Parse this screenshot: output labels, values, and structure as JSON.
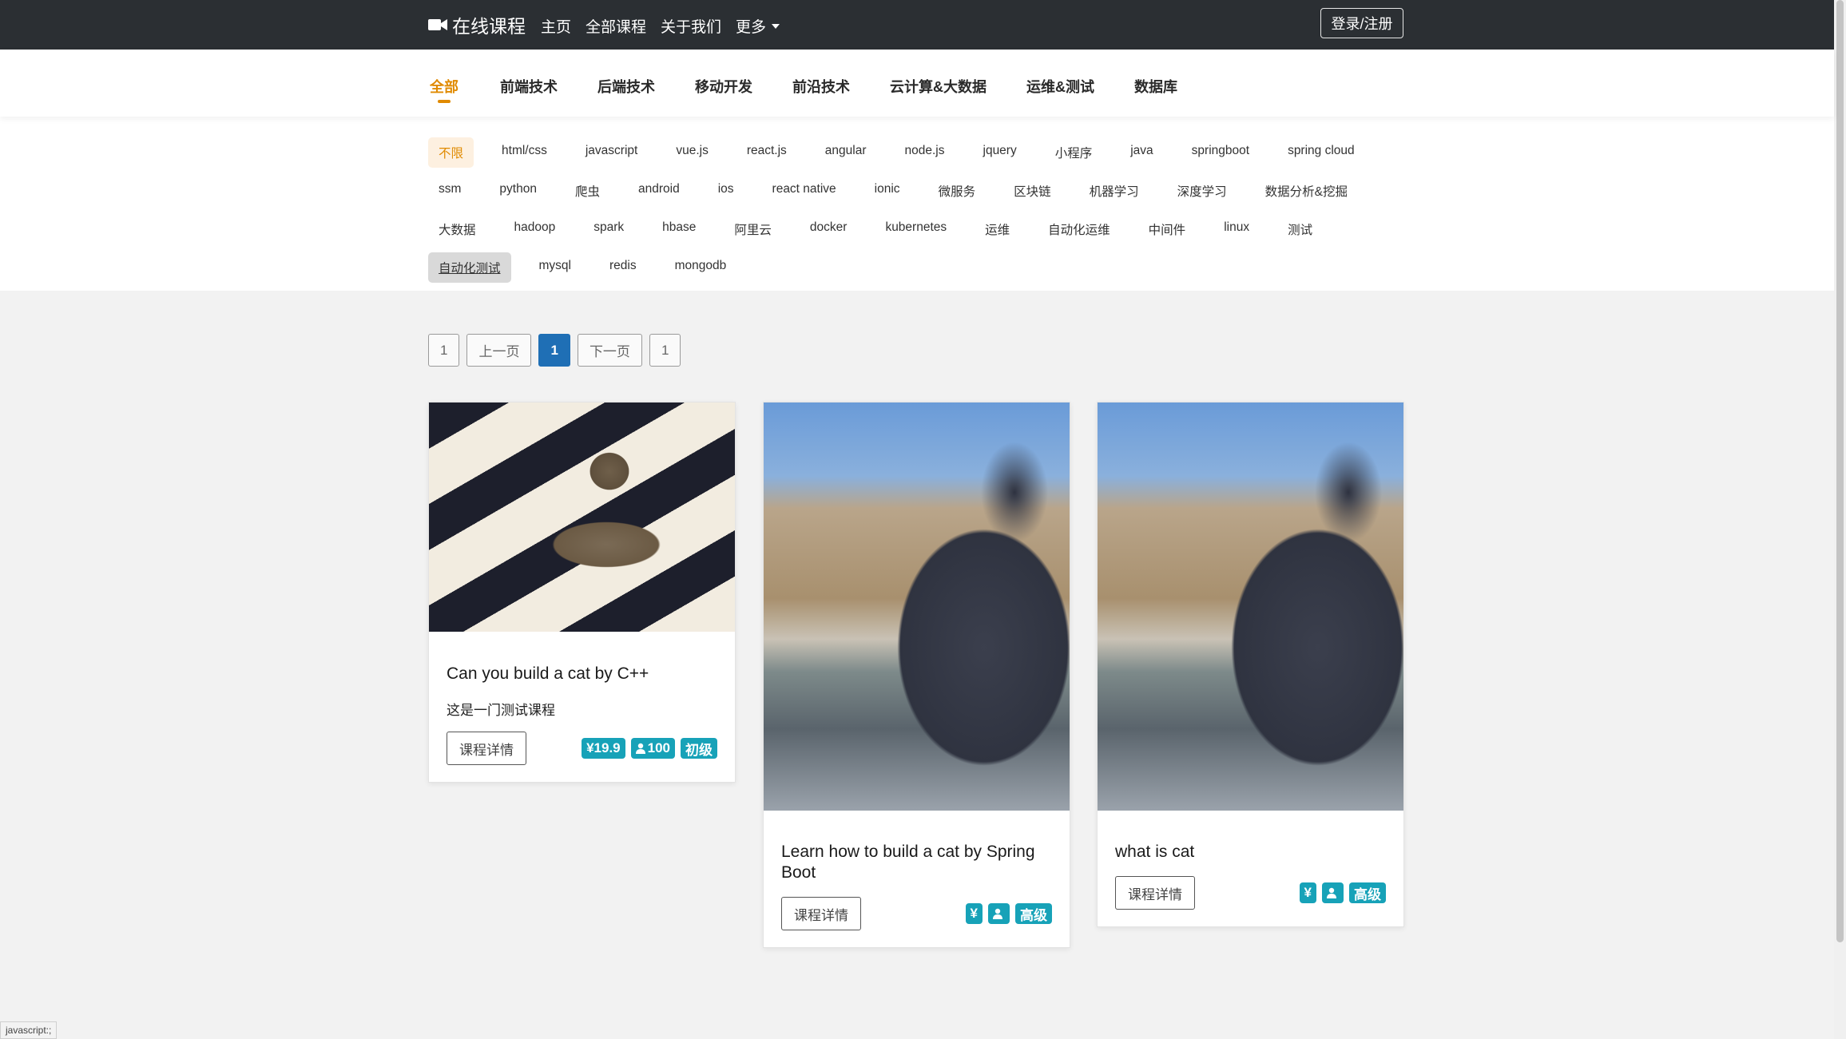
{
  "brand": {
    "name": "在线课程"
  },
  "nav": {
    "items": [
      "主页",
      "全部课程",
      "关于我们",
      "更多"
    ],
    "login": "登录/注册"
  },
  "categories": [
    "全部",
    "前端技术",
    "后端技术",
    "移动开发",
    "前沿技术",
    "云计算&大数据",
    "运维&测试",
    "数据库"
  ],
  "tags": {
    "row1": [
      "不限",
      "html/css",
      "javascript",
      "vue.js",
      "react.js",
      "angular",
      "node.js",
      "jquery",
      "小程序",
      "java",
      "springboot",
      "spring cloud"
    ],
    "row2": [
      "ssm",
      "python",
      "爬虫",
      "android",
      "ios",
      "react native",
      "ionic",
      "微服务",
      "区块链",
      "机器学习",
      "深度学习",
      "数据分析&挖掘"
    ],
    "row3": [
      "大数据",
      "hadoop",
      "spark",
      "hbase",
      "阿里云",
      "docker",
      "kubernetes",
      "运维",
      "自动化运维",
      "中间件",
      "linux",
      "测试"
    ],
    "row4": [
      "自动化测试",
      "mysql",
      "redis",
      "mongodb"
    ]
  },
  "pagination": {
    "first": "1",
    "prev": "上一页",
    "current": "1",
    "next": "下一页",
    "last": "1"
  },
  "courses": [
    {
      "title": "Can you build a cat by C++",
      "desc": "这是一门测试课程",
      "button": "课程详情",
      "price": "¥19.9",
      "students": "100",
      "level": "初级"
    },
    {
      "title": "Learn how to build a cat by Spring Boot",
      "button": "课程详情",
      "price": "¥",
      "students": "",
      "level": "高级"
    },
    {
      "title": "what is cat",
      "button": "课程详情",
      "price": "¥",
      "students": "",
      "level": "高级"
    }
  ],
  "status_bar": "javascript:;",
  "colors": {
    "accent": "#e08a00",
    "badge": "#17a2b8",
    "navbar": "#2b2f33",
    "page_active": "#1f6fb5"
  }
}
